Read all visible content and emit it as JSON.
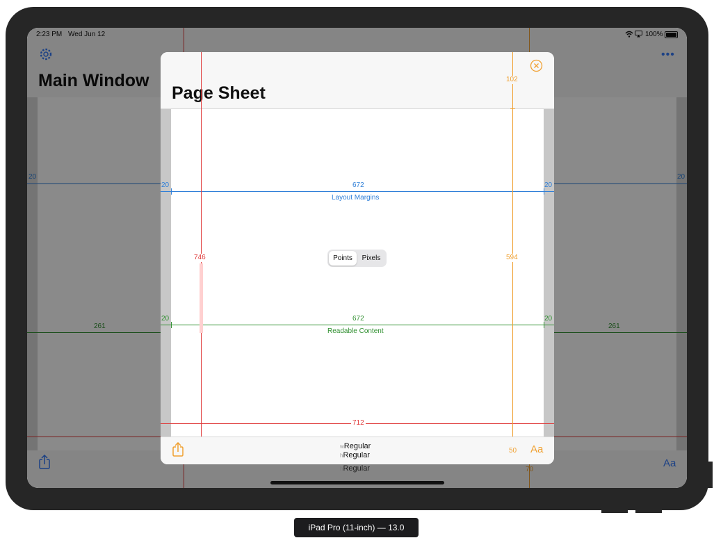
{
  "status_bar": {
    "time": "2:23 PM",
    "date": "Wed Jun 12",
    "battery": "100%"
  },
  "main_window": {
    "title": "Main Window",
    "left_margin": "20",
    "right_margin": "20",
    "readable_left": "261",
    "readable_right": "261",
    "font_button": "Aa"
  },
  "sheet": {
    "title": "Page Sheet",
    "top_height": "102",
    "total_height": "746",
    "content_height": "594",
    "bottom_height": "50",
    "below_height": "70",
    "layout_margins": {
      "left": "20",
      "width": "672",
      "right": "20",
      "label": "Layout Margins"
    },
    "readable_content": {
      "left": "20",
      "width": "672",
      "right": "20",
      "label": "Readable Content"
    },
    "full_width": "712",
    "units_toggle": {
      "options": [
        "Points",
        "Pixels"
      ],
      "selected": "Points"
    },
    "size_classes": {
      "w_prefix": "w",
      "w_value": "Regular",
      "h_prefix": "h",
      "h_value": "Regular",
      "h2_prefix": "h",
      "h2_value": "Regular"
    },
    "font_button": "Aa"
  },
  "caption": "iPad Pro (11-inch) — 13.0",
  "icons": [
    "gear-icon",
    "ellipsis-icon",
    "close-icon",
    "share-icon",
    "wifi-icon",
    "screen-mirror-icon",
    "battery-icon"
  ],
  "colors": {
    "layout_margin": "#2f7fd8",
    "readable_content": "#2f8f2f",
    "height_total": "#e03a3a",
    "height_parts": "#f0a030",
    "device": "#262626"
  }
}
